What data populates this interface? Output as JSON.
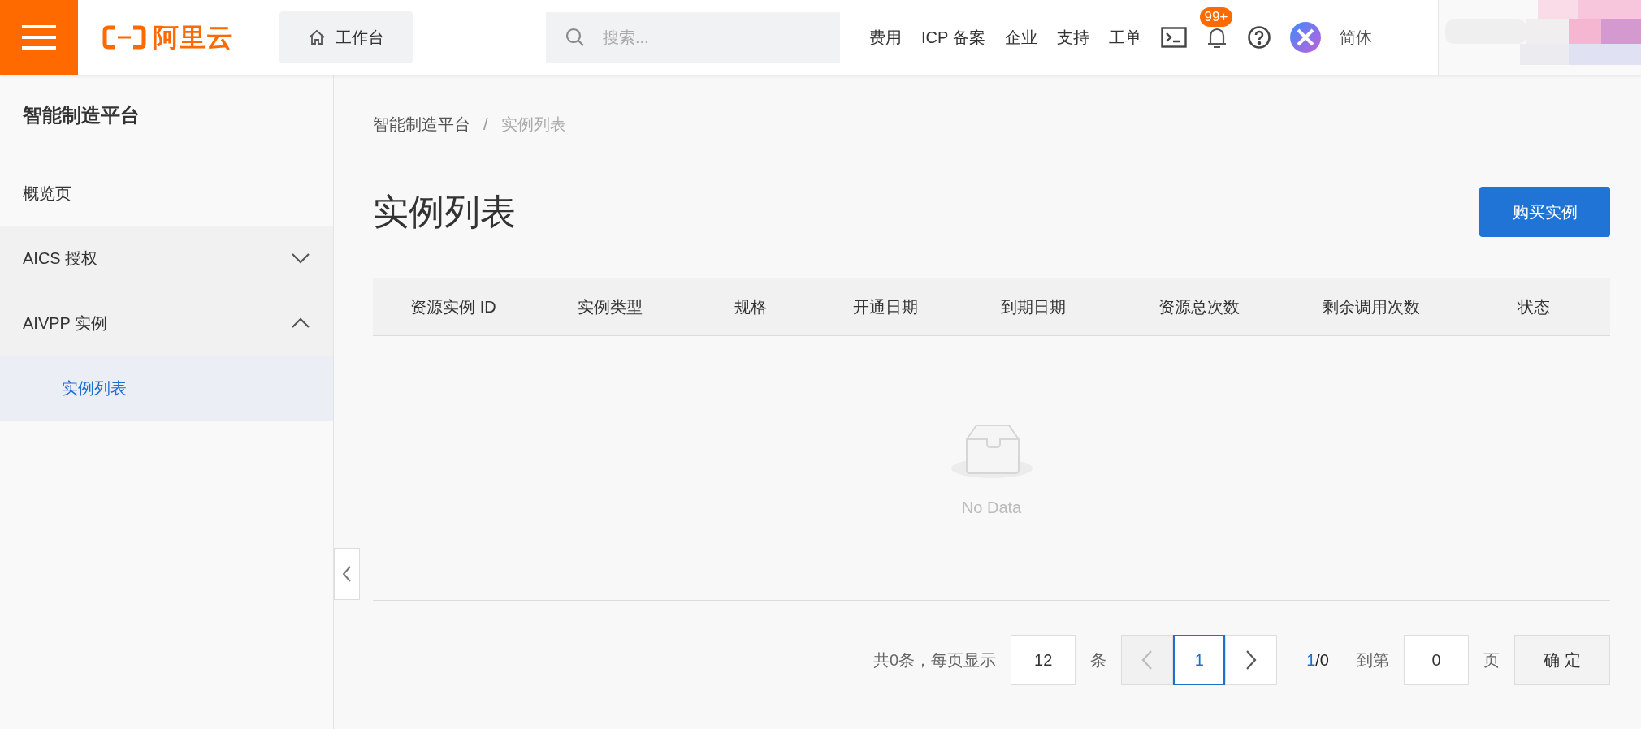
{
  "topbar": {
    "logo": "阿里云",
    "workbench": "工作台",
    "search": {
      "placeholder": "搜索..."
    },
    "nav_links": [
      "费用",
      "ICP 备案",
      "企业",
      "支持",
      "工单"
    ],
    "notification_badge": "99+",
    "language": "简体"
  },
  "sidebar": {
    "title": "智能制造平台",
    "items": [
      {
        "kind": "link",
        "label": "概览页",
        "selected": false
      },
      {
        "kind": "group",
        "label": "AICS 授权",
        "expanded": false
      },
      {
        "kind": "group",
        "label": "AIVPP 实例",
        "expanded": true,
        "children": [
          {
            "label": "实例列表",
            "selected": true
          }
        ]
      }
    ]
  },
  "breadcrumb": {
    "separator": "/",
    "items": [
      "智能制造平台",
      "实例列表"
    ]
  },
  "page_title": "实例列表",
  "buy_button": "购买实例",
  "table": {
    "columns": [
      "资源实例 ID",
      "实例类型",
      "规格",
      "开通日期",
      "到期日期",
      "资源总次数",
      "剩余调用次数",
      "状态"
    ],
    "empty_text": "No Data"
  },
  "pagination": {
    "summary": "共0条，每页显示",
    "page_size": "12",
    "size_unit": "条",
    "prev_disabled": true,
    "pages": [
      {
        "label": "1",
        "selected": true
      }
    ],
    "current": "1",
    "total": "/0",
    "jump_label": "到第",
    "jump_value": "0",
    "jump_unit": "页",
    "confirm": "确 定"
  }
}
